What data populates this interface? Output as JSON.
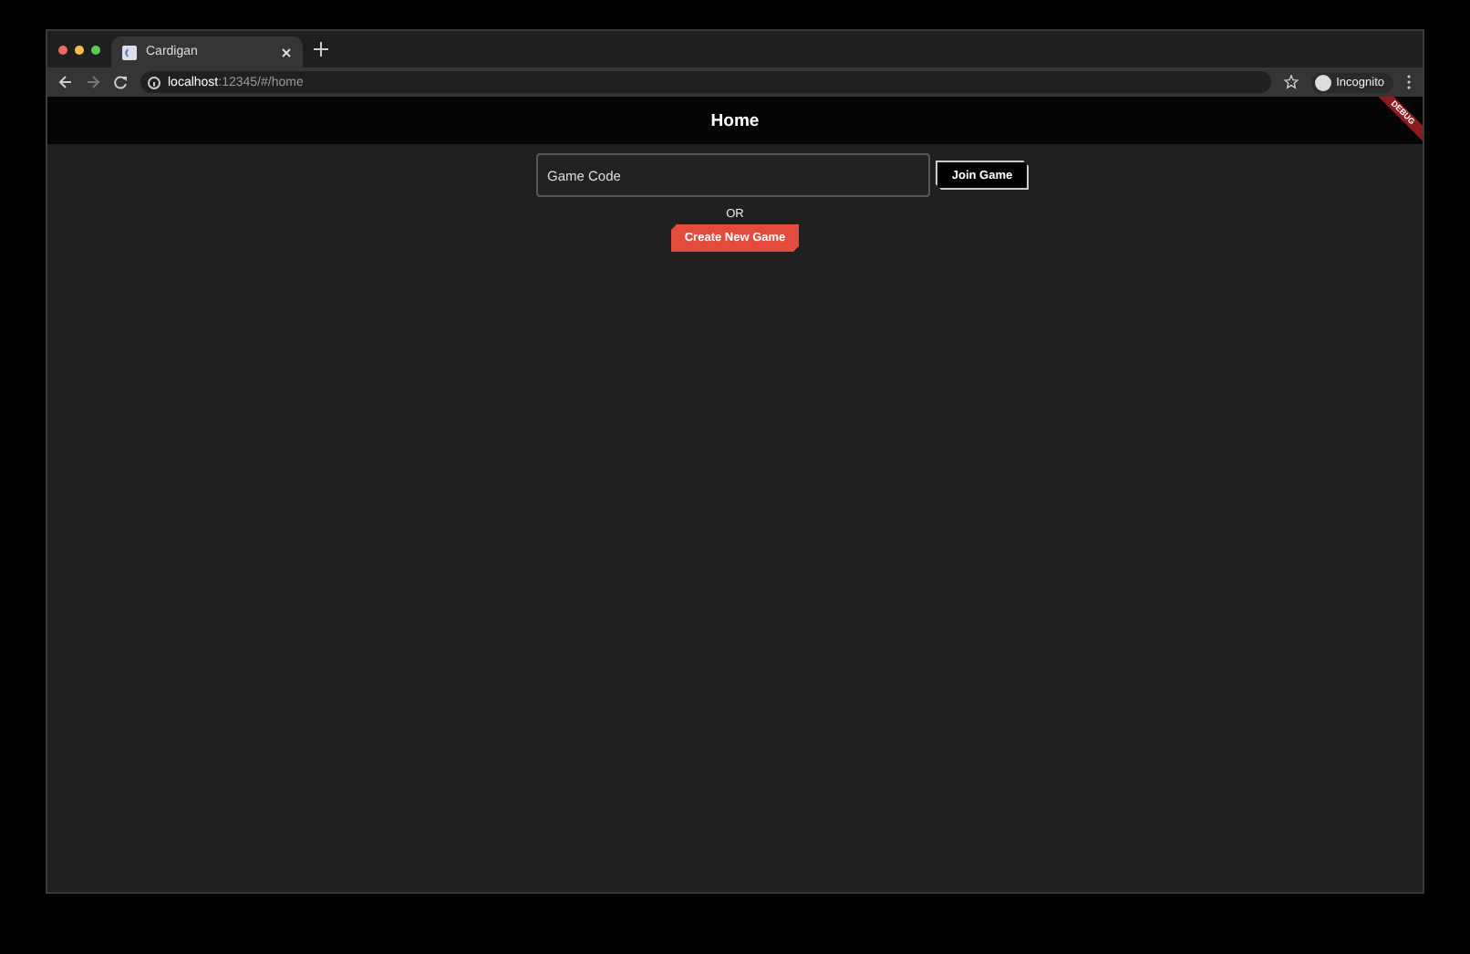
{
  "browser": {
    "tab": {
      "title": "Cardigan",
      "selected": true
    },
    "url": "**localhost**:12345/#/home",
    "profile": "Incognito"
  },
  "app_bar": {
    "title": "Home",
    "debug_banner": "DEBUG"
  },
  "join": {
    "field": {
      "placeholder": "Game Code"
    },
    "button": "Join Game"
  },
  "separator": "OR",
  "create_button": "Create New Game"
}
